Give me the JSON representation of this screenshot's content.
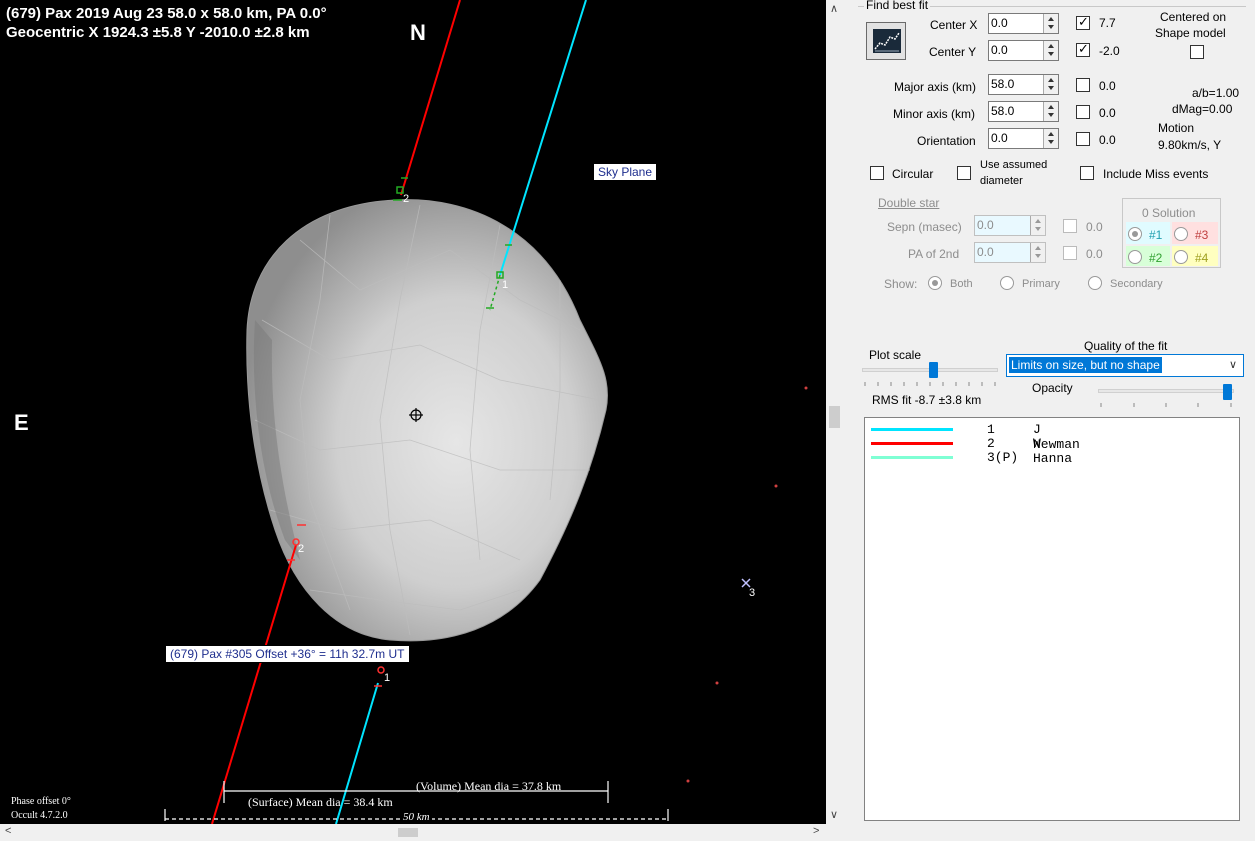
{
  "plot": {
    "header_line1": "(679) Pax  2019 Aug 23  58.0 x 58.0 km, PA 0.0°",
    "header_line2": "Geocentric  X  1924.3 ±5.8  Y -2010.0 ±2.8 km",
    "north": "N",
    "east": "E",
    "sky_plane": "Sky Plane",
    "shape_label": "(679) Pax #305  Offset +36° = 11h 32.7m UT",
    "volume_dia": "(Volume) Mean dia = 37.8 km",
    "surface_dia": "(Surface) Mean dia = 38.4 km",
    "scale_bar": "50 km",
    "phase_offset": "Phase offset 0°",
    "version": "Occult 4.7.2.0",
    "chord_labels": [
      "2",
      "1",
      "2",
      "1",
      "3"
    ]
  },
  "panel": {
    "find_best_fit": "Find best fit",
    "center_x_label": "Center X",
    "center_x_value": "0.0",
    "center_x_fit": "7.7",
    "center_y_label": "Center Y",
    "center_y_value": "0.0",
    "center_y_fit": "-2.0",
    "centered_on": "Centered on",
    "shape_model": "Shape model",
    "major_label": "Major axis (km)",
    "major_value": "58.0",
    "major_fit": "0.0",
    "minor_label": "Minor axis (km)",
    "minor_value": "58.0",
    "minor_fit": "0.0",
    "orient_label": "Orientation",
    "orient_value": "0.0",
    "orient_fit": "0.0",
    "ab": "a/b=1.00",
    "dmag": "dMag=0.00",
    "motion": "Motion",
    "motion_val": "9.80km/s, Y",
    "circular": "Circular",
    "use_assumed": "Use assumed",
    "diameter": "diameter",
    "include_miss": "Include Miss events",
    "double_star": "Double star",
    "sepn_label": "Sepn (masec)",
    "sepn_value": "0.0",
    "sepn_fit": "0.0",
    "pa2_label": "PA of 2nd",
    "pa2_value": "0.0",
    "pa2_fit": "0.0",
    "solution": "0 Solution",
    "sol1": "#1",
    "sol2": "#2",
    "sol3": "#3",
    "sol4": "#4",
    "show": "Show:",
    "show_both": "Both",
    "show_primary": "Primary",
    "show_secondary": "Secondary",
    "plot_scale": "Plot scale",
    "quality": "Quality of the fit",
    "quality_value": "Limits on size, but no shape",
    "opacity": "Opacity",
    "rms": "RMS fit -8.7 ±3.8 km",
    "colors": {
      "cyan": "#00e5ff",
      "red": "#ff0000",
      "aqua": "#7fffd4"
    },
    "legend": [
      {
        "num": "1",
        "name": "J Newman"
      },
      {
        "num": "2",
        "name": "W Hanna"
      },
      {
        "num": "3(P)",
        "name": ""
      }
    ]
  }
}
